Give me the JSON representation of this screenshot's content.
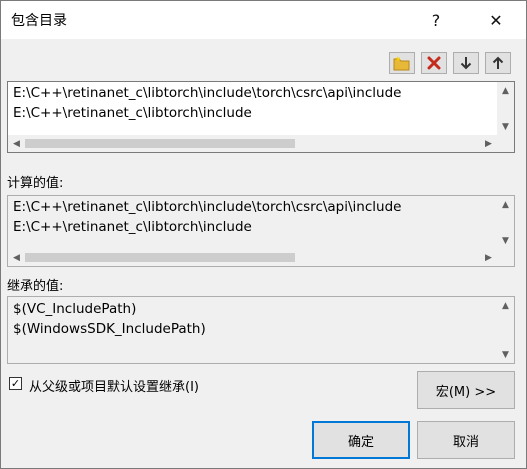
{
  "window": {
    "title": "包含目录",
    "help_glyph": "?",
    "close_glyph": "✕"
  },
  "toolbar": {
    "icons": [
      "new-folder-icon",
      "delete-icon",
      "move-down-icon",
      "move-up-icon"
    ],
    "colors": {
      "delete": "#c42b1c",
      "folder": "#e8b838"
    }
  },
  "edit_list": {
    "lines": [
      "E:\\C++\\retinanet_c\\libtorch\\include\\torch\\csrc\\api\\include",
      "E:\\C++\\retinanet_c\\libtorch\\include"
    ]
  },
  "computed": {
    "label": "计算的值:",
    "lines": [
      "E:\\C++\\retinanet_c\\libtorch\\include\\torch\\csrc\\api\\include",
      "E:\\C++\\retinanet_c\\libtorch\\include"
    ]
  },
  "inherited": {
    "label": "继承的值:",
    "lines": [
      "$(VC_IncludePath)",
      "$(WindowsSDK_IncludePath)"
    ]
  },
  "inherit_checkbox": {
    "label": "从父级或项目默认设置继承(I)",
    "checked": true,
    "check_glyph": "✓"
  },
  "buttons": {
    "macro": "宏(M) >>",
    "ok": "确定",
    "cancel": "取消"
  },
  "colors": {
    "accent": "#0078d7"
  }
}
